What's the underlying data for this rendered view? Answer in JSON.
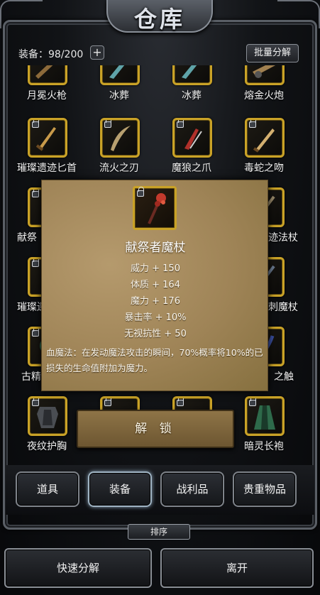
{
  "title": "仓库",
  "header": {
    "count_label": "装备：98/200",
    "plus_label": "+",
    "batch_label": "批量分解"
  },
  "colors": {
    "slot_border": "#c9a227",
    "parchment": "#a08657",
    "frame": "#5a5f66"
  },
  "inventory": [
    {
      "name": "月冕火枪",
      "icon": "musket-icon",
      "locked": false
    },
    {
      "name": "冰葬",
      "icon": "ice-blade-icon",
      "locked": false
    },
    {
      "name": "冰葬",
      "icon": "ice-blade-icon",
      "locked": false
    },
    {
      "name": "熔金火炮",
      "icon": "cannon-icon",
      "locked": false
    },
    {
      "name": "璀璨遗迹匕首",
      "icon": "dagger-icon",
      "locked": true
    },
    {
      "name": "流火之刃",
      "icon": "curved-blade-icon",
      "locked": true
    },
    {
      "name": "魔狼之爪",
      "icon": "claw-icon",
      "locked": true
    },
    {
      "name": "毒蛇之吻",
      "icon": "serpent-blade-icon",
      "locked": true
    },
    {
      "name": "献祭",
      "icon": "staff-icon",
      "locked": true
    },
    {
      "name": "迹法杖",
      "icon": "staff-icon",
      "locked": true
    },
    {
      "name": "璀璨遗",
      "icon": "staff-icon",
      "locked": true
    },
    {
      "name": "刺魔杖",
      "icon": "wand-icon",
      "locked": true
    },
    {
      "name": "古精",
      "icon": "orb-icon",
      "locked": true
    },
    {
      "name": "之触",
      "icon": "tentacle-icon",
      "locked": true
    },
    {
      "name": "夜纹护胸",
      "icon": "chestplate-icon",
      "locked": true
    },
    {
      "name": "暗灵长袍",
      "icon": "robe-icon",
      "locked": true
    }
  ],
  "popup": {
    "item_name": "献祭者魔杖",
    "icon": "bloody-staff-icon",
    "stats": [
      "威力 + 150",
      "体质 + 164",
      "魔力 + 176",
      "暴击率 + 10%",
      "无视抗性 + 50"
    ],
    "description": "血魔法：在发动魔法攻击的瞬间，70%概率将10%的已损失的生命值附加为魔力。"
  },
  "unlock_label": "解 锁",
  "tabs": [
    {
      "label": "道具",
      "active": false
    },
    {
      "label": "装备",
      "active": true
    },
    {
      "label": "战利品",
      "active": false
    },
    {
      "label": "贵重物品",
      "active": false
    }
  ],
  "sort_label": "排序",
  "bottom": {
    "quick_decompose": "快速分解",
    "leave": "离开"
  }
}
